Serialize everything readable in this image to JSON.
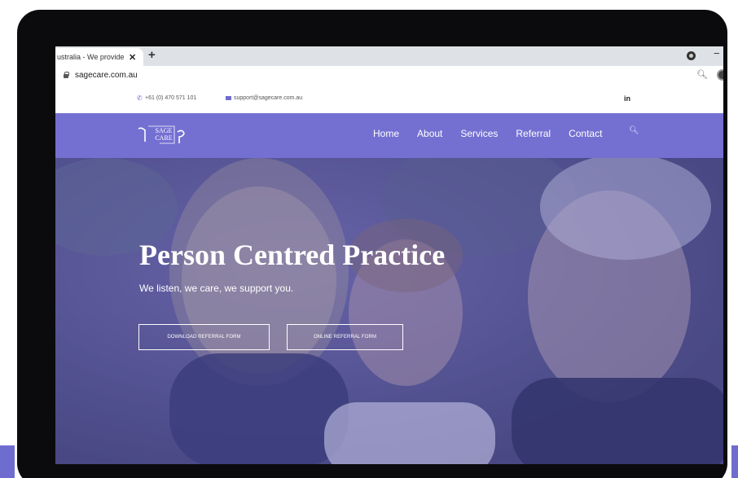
{
  "browser": {
    "tab_title": "ustralia - We provide",
    "tab_close": "✕",
    "new_tab": "+",
    "url": "sagecare.com.au"
  },
  "website": {
    "infobar": {
      "phone": "+61 (0) 470 571 101",
      "email": "support@sagecare.com.au",
      "social": "in"
    },
    "logo": {
      "line1": "SAGE",
      "line2": "CARE"
    },
    "nav": [
      {
        "label": "Home"
      },
      {
        "label": "About"
      },
      {
        "label": "Services"
      },
      {
        "label": "Referral"
      },
      {
        "label": "Contact"
      }
    ],
    "hero": {
      "title": "Person Centred Practice",
      "subtitle": "We listen, we care, we support you.",
      "button_download": "DOWNLOAD REFERRAL FORM",
      "button_online": "ONLINE REFERRAL FORM"
    }
  },
  "colors": {
    "brand": "#7470d2",
    "device_frame": "#0b0b0d"
  }
}
